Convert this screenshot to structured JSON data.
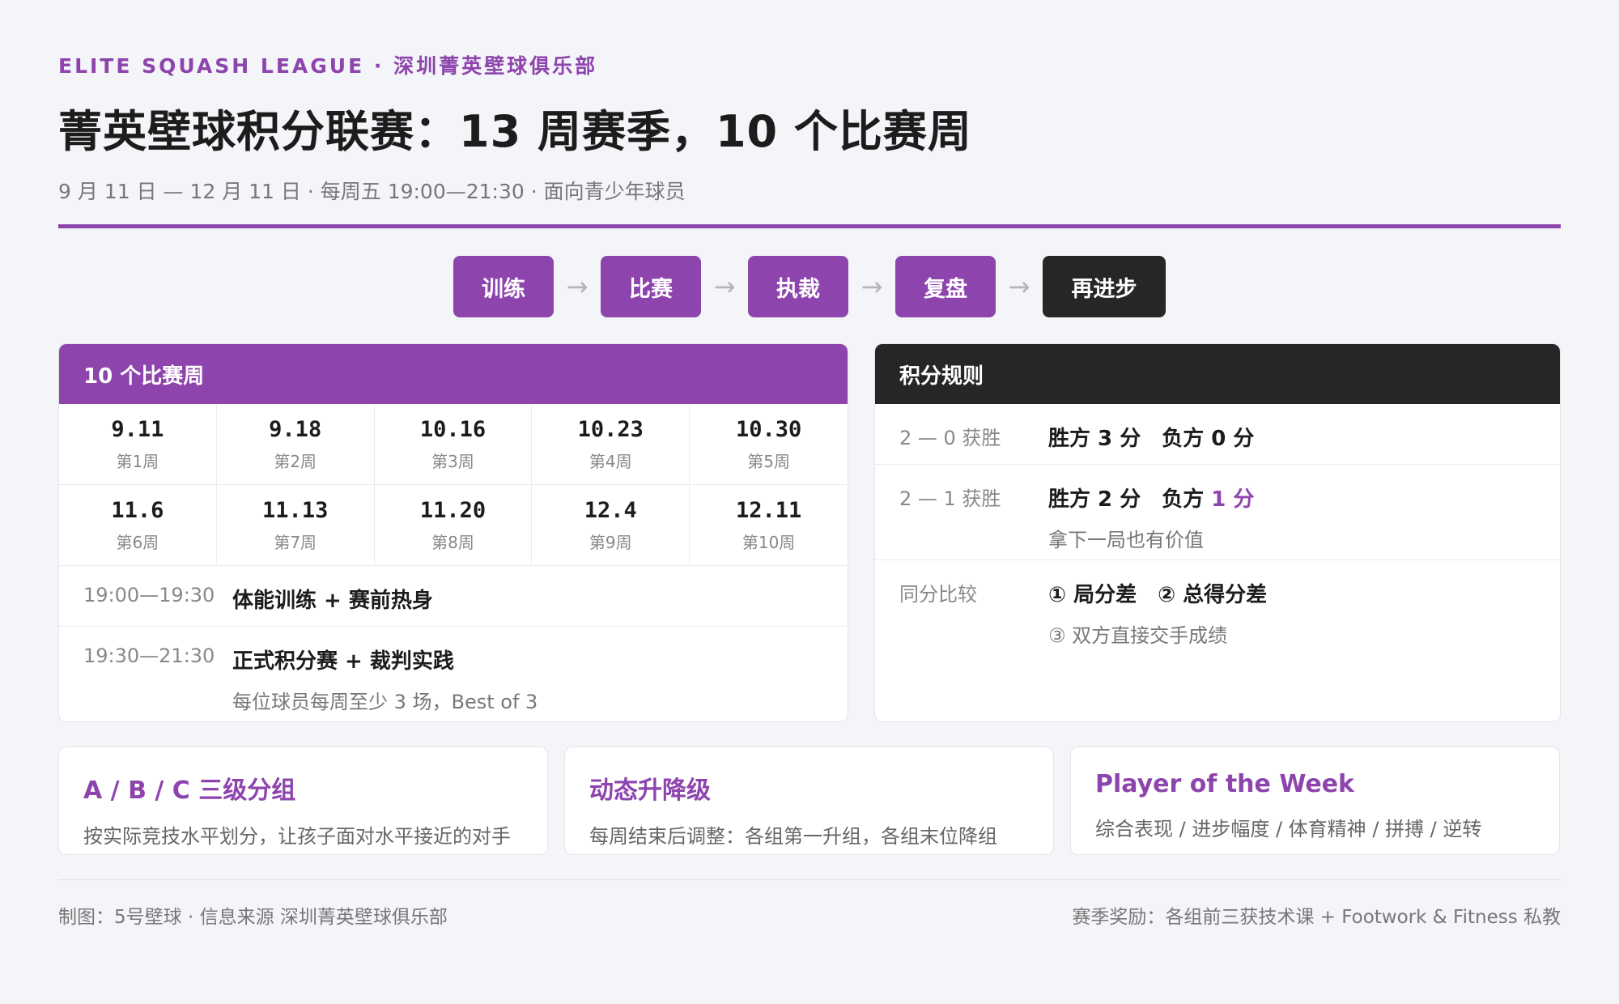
{
  "header": {
    "kicker": "ELITE SQUASH LEAGUE · 深圳菁英壁球俱乐部",
    "title": "菁英壁球积分联赛：13 周赛季，10 个比赛周",
    "subtitle": "9 月 11 日 — 12 月 11 日 · 每周五 19:00—21:30 · 面向青少年球员"
  },
  "flow": {
    "steps": [
      "训练",
      "比赛",
      "执裁",
      "复盘",
      "再进步"
    ],
    "arrow": "→"
  },
  "weeks_card": {
    "title": "10 个比赛周",
    "weeks": [
      {
        "date": "9.11",
        "label": "第1周"
      },
      {
        "date": "9.18",
        "label": "第2周"
      },
      {
        "date": "10.16",
        "label": "第3周"
      },
      {
        "date": "10.23",
        "label": "第4周"
      },
      {
        "date": "10.30",
        "label": "第5周"
      },
      {
        "date": "11.6",
        "label": "第6周"
      },
      {
        "date": "11.13",
        "label": "第7周"
      },
      {
        "date": "11.20",
        "label": "第8周"
      },
      {
        "date": "12.4",
        "label": "第9周"
      },
      {
        "date": "12.11",
        "label": "第10周"
      }
    ],
    "schedule": [
      {
        "time": "19:00—19:30",
        "main": "体能训练 + 赛前热身",
        "sub": ""
      },
      {
        "time": "19:30—21:30",
        "main": "正式积分赛 + 裁判实践",
        "sub": "每位球员每周至少 3 场，Best of 3"
      }
    ]
  },
  "rules_card": {
    "title": "积分规则",
    "rows": [
      {
        "label": "2 — 0 获胜",
        "win": "胜方 3 分",
        "lose_prefix": "负方",
        "lose_points": "0 分",
        "sub": ""
      },
      {
        "label": "2 — 1 获胜",
        "win": "胜方 2 分",
        "lose_prefix": "负方",
        "lose_points": "1 分",
        "sub": "拿下一局也有价值"
      },
      {
        "label": "同分比较",
        "main": "① 局分差　② 总得分差",
        "sub": "③ 双方直接交手成绩"
      }
    ]
  },
  "features": [
    {
      "title": "A / B / C 三级分组",
      "desc": "按实际竞技水平划分，让孩子面对水平接近的对手"
    },
    {
      "title": "动态升降级",
      "desc": "每周结束后调整：各组第一升组，各组末位降组"
    },
    {
      "title": "Player of the Week",
      "desc": "综合表现 / 进步幅度 / 体育精神 / 拼搏 / 逆转"
    }
  ],
  "footer": {
    "left": "制图：5号壁球 · 信息来源 深圳菁英壁球俱乐部",
    "right": "赛季奖励：各组前三获技术课 + Footwork & Fitness 私教"
  },
  "colors": {
    "accent": "#8e44ad",
    "dark": "#262626",
    "background": "#f3f5f8"
  }
}
